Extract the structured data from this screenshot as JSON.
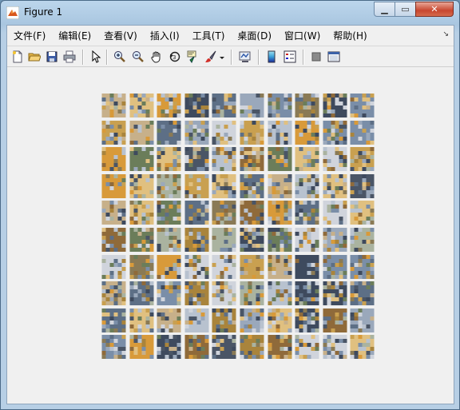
{
  "window": {
    "title": "Figure 1",
    "controls": {
      "minimize": "▁",
      "maximize": "▭",
      "close": "✕"
    }
  },
  "menu": {
    "items": [
      "文件(F)",
      "编辑(E)",
      "查看(V)",
      "插入(I)",
      "工具(T)",
      "桌面(D)",
      "窗口(W)",
      "帮助(H)"
    ],
    "overflow_icon": "chevron-icon"
  },
  "toolbar": {
    "buttons": [
      "new-figure-icon",
      "open-file-icon",
      "save-icon",
      "print-icon",
      "edit-plot-arrow-icon",
      "zoom-in-icon",
      "zoom-out-icon",
      "pan-hand-icon",
      "rotate-3d-icon",
      "data-cursor-icon",
      "brush-icon",
      "brush-dropdown-icon",
      "link-plot-icon",
      "colorbar-icon",
      "legend-icon",
      "hide-plot-tools-icon",
      "show-plot-tools-icon"
    ]
  },
  "figure": {
    "rows": 10,
    "cols": 10,
    "palette": [
      "#7a8ea8",
      "#a9843c",
      "#c9a050",
      "#5d6f86",
      "#b8c2cf",
      "#8a7a55",
      "#d89a3a",
      "#3e4a5e",
      "#9aa8bb",
      "#c7b08a",
      "#6b7d5a",
      "#e0c080",
      "#4a5566",
      "#aab3a0",
      "#d0d4dc",
      "#8f6a3a"
    ]
  }
}
